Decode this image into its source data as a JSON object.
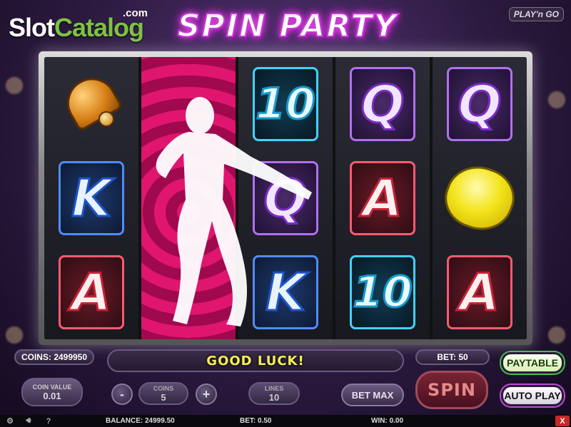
{
  "branding": {
    "site_logo_main": "Slot",
    "site_logo_accent": "Catalog",
    "site_logo_suffix": ".com",
    "game_title": "SPIN PARTY",
    "provider": "PLAY'n GO"
  },
  "reels": [
    [
      "bell",
      "K",
      "A"
    ],
    [
      "wild",
      "wild",
      "wild"
    ],
    [
      "10",
      "Q",
      "K"
    ],
    [
      "Q",
      "A",
      "10"
    ],
    [
      "Q",
      "lemon",
      "A"
    ]
  ],
  "controls": {
    "coins_label": "COINS:",
    "coins_value": "2499950",
    "message": "GOOD LUCK!",
    "bet_label": "BET:",
    "bet_value": "50",
    "paytable_label": "PAYTABLE",
    "autoplay_label": "AUTO PLAY",
    "coin_value_label": "COIN VALUE",
    "coin_value": "0.01",
    "minus_label": "-",
    "plus_label": "+",
    "coins_step_label": "COINS",
    "coins_step_value": "5",
    "lines_label": "LINES",
    "lines_value": "10",
    "bet_max_label": "BET MAX",
    "spin_label": "SPIN"
  },
  "status_bar": {
    "settings_icon": "gear-icon",
    "sound_icon": "speaker-icon",
    "help_icon": "?",
    "balance_label": "BALANCE:",
    "balance_value": "24999.50",
    "bet_label": "BET:",
    "bet_value": "0.50",
    "win_label": "WIN:",
    "win_value": "0.00",
    "close_label": "X"
  },
  "colors": {
    "accent_purple": "#c63bd8",
    "wild_reel": "#e0156f",
    "message_yellow": "#f7ee55",
    "paytable_green": "#43c14a"
  }
}
